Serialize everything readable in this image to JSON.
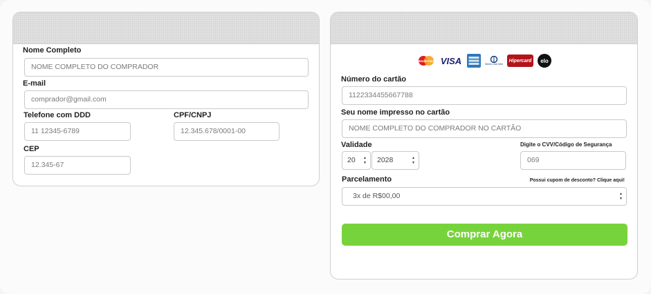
{
  "buyer": {
    "name_label": "Nome Completo",
    "name_placeholder": "NOME COMPLETO DO COMPRADOR",
    "email_label": "E-mail",
    "email_placeholder": "comprador@gmail.com",
    "phone_label": "Telefone com DDD",
    "phone_placeholder": "11 12345-6789",
    "cpf_label": "CPF/CNPJ",
    "cpf_placeholder": "12.345.678/0001-00",
    "cep_label": "CEP",
    "cep_placeholder": "12.345-67"
  },
  "payment": {
    "card_brands": [
      "MasterCard",
      "VISA",
      "AMERICAN EXPRESS",
      "Diners Club International",
      "Hipercard",
      "elo"
    ],
    "card_number_label": "Número do cartão",
    "card_number_placeholder": "1122334455667788",
    "card_name_label": "Seu nome impresso no cartão",
    "card_name_placeholder": "NOME COMPLETO DO COMPRADOR NO CARTÃO",
    "validity_label": "Validade",
    "month_value": "20",
    "year_value": "2028",
    "cvv_label": "Digite o CVV/Código de Segurança",
    "cvv_placeholder": "069",
    "installments_label": "Parcelamento",
    "coupon_text": "Possui cupom de desconto? Clique aqui!",
    "installments_value": "3x de R$00,00",
    "buy_button": "Comprar Agora"
  },
  "colors": {
    "button": "#77d33b",
    "header": "#e2e2e2"
  }
}
